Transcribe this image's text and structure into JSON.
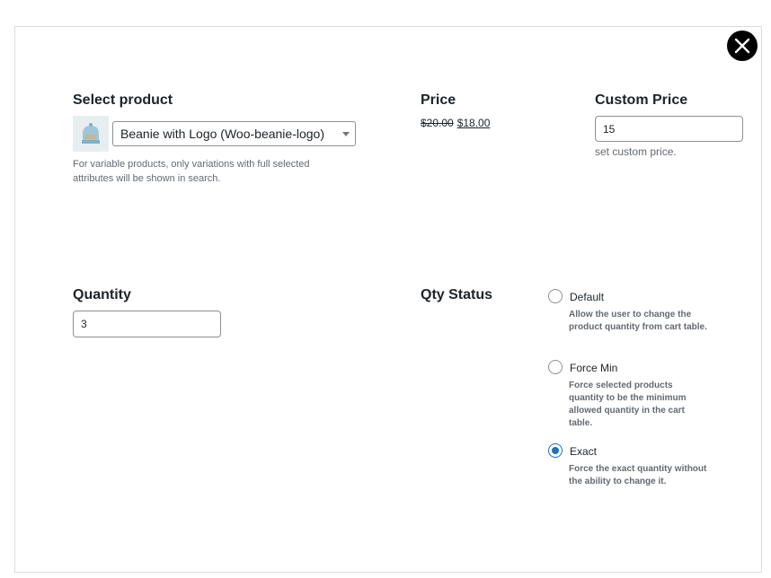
{
  "product": {
    "heading": "Select product",
    "thumbnail_icon": "beanie-product-thumbnail",
    "selected": "Beanie with Logo (Woo-beanie-logo)",
    "help_text": "For variable products, only variations with full selected attributes will be shown in search."
  },
  "price": {
    "heading": "Price",
    "regular": "$20.00",
    "sale": "$18.00"
  },
  "custom_price": {
    "heading": "Custom Price",
    "value": "15",
    "description": "set custom price."
  },
  "quantity": {
    "heading": "Quantity",
    "value": "3"
  },
  "qty_status": {
    "heading": "Qty Status",
    "options": [
      {
        "label": "Default",
        "description": "Allow the user to change the product quantity from cart table.",
        "checked": false
      },
      {
        "label": "Force Min",
        "description": "Force selected products quantity to be the minimum allowed quantity in the cart table.",
        "checked": false
      },
      {
        "label": "Exact",
        "description": "Force the exact quantity without the ability to change it.",
        "checked": true
      }
    ]
  },
  "colors": {
    "accent": "#2271b1",
    "border": "#8c8f94",
    "muted_text": "#646970"
  }
}
